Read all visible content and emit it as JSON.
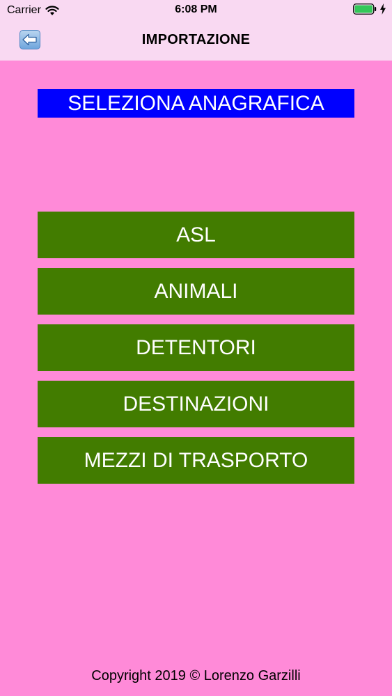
{
  "status_bar": {
    "carrier": "Carrier",
    "time": "6:08 PM"
  },
  "nav": {
    "title": "IMPORTAZIONE",
    "back_icon": "back-arrow-icon"
  },
  "heading": "SELEZIONA ANAGRAFICA",
  "menu": [
    {
      "label": "ASL"
    },
    {
      "label": "ANIMALI"
    },
    {
      "label": "DETENTORI"
    },
    {
      "label": "DESTINAZIONI"
    },
    {
      "label": "MEZZI DI TRASPORTO"
    }
  ],
  "footer": "Copyright 2019 © Lorenzo Garzilli",
  "colors": {
    "background": "#ff8ad8",
    "bar": "#f9d9f2",
    "heading_bg": "#0000ff",
    "button_bg": "#427c00"
  }
}
